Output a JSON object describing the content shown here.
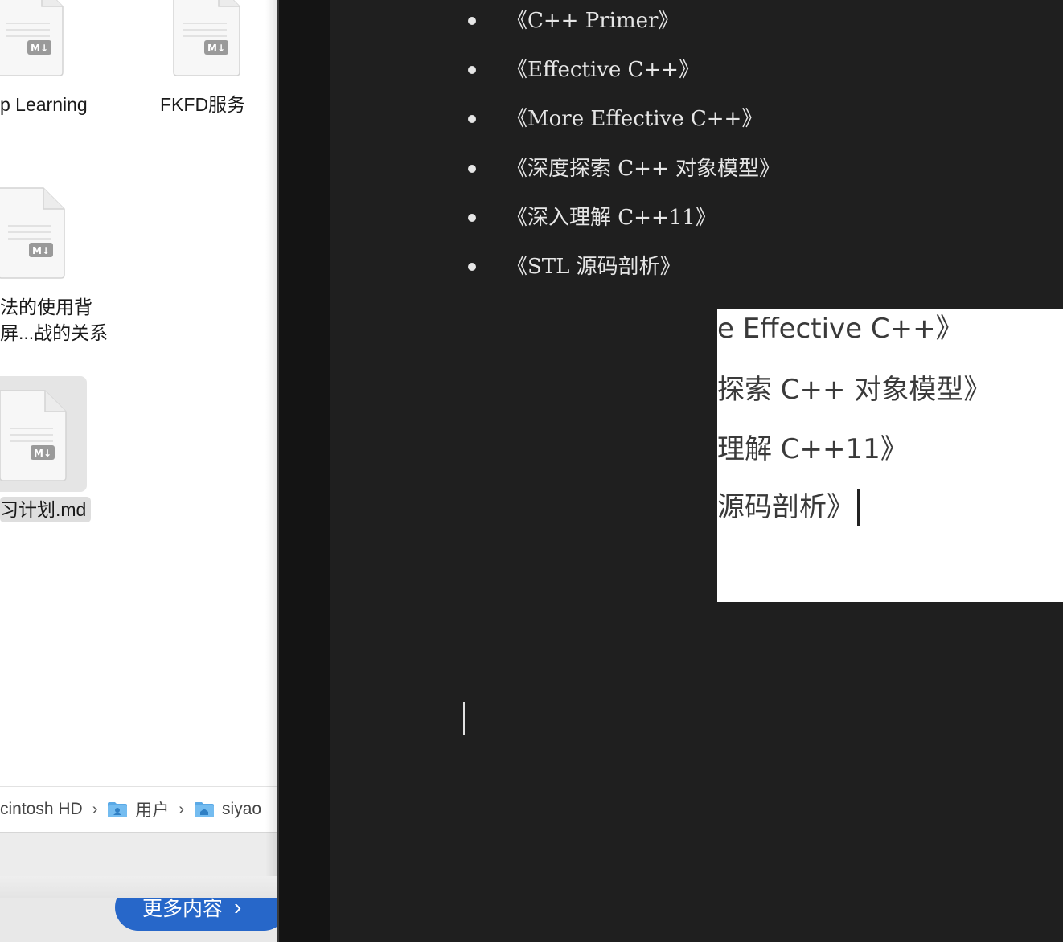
{
  "finder": {
    "files": [
      {
        "label": "p Learning",
        "icon": "markdown-file-icon",
        "badge": "M↓"
      },
      {
        "label": "FKFD服务",
        "icon": "markdown-file-icon",
        "badge": "M↓"
      },
      {
        "label_line1": "法的使用背",
        "label_line2": "屏...战的关系",
        "icon": "markdown-file-icon",
        "badge": "M↓"
      },
      {
        "label": "习计划.md",
        "icon": "markdown-file-icon",
        "badge": "M↓",
        "selected": true
      }
    ],
    "path_bar": [
      {
        "label": "cintosh HD",
        "icon": ""
      },
      {
        "label": "用户",
        "icon": "users-folder-icon"
      },
      {
        "label": "siyao",
        "icon": "home-folder-icon"
      }
    ],
    "path_separator": "›",
    "more_button_label": "更多内容",
    "more_button_icon": "chevron-right-icon"
  },
  "editor": {
    "books": [
      "《C++ Primer》",
      "《Effective C++》",
      "《More Effective C++》",
      "《深度探索 C++ 对象模型》",
      "《深入理解 C++11》",
      "《STL 源码剖析》"
    ]
  },
  "zoom_preview": {
    "lines": [
      "e Effective C++》",
      "探索 C++ 对象模型》",
      "理解 C++11》",
      "源码剖析》"
    ]
  },
  "colors": {
    "editor_bg": "#1f1f1f",
    "finder_bg": "#ffffff",
    "accent_button": "#2767c9"
  }
}
